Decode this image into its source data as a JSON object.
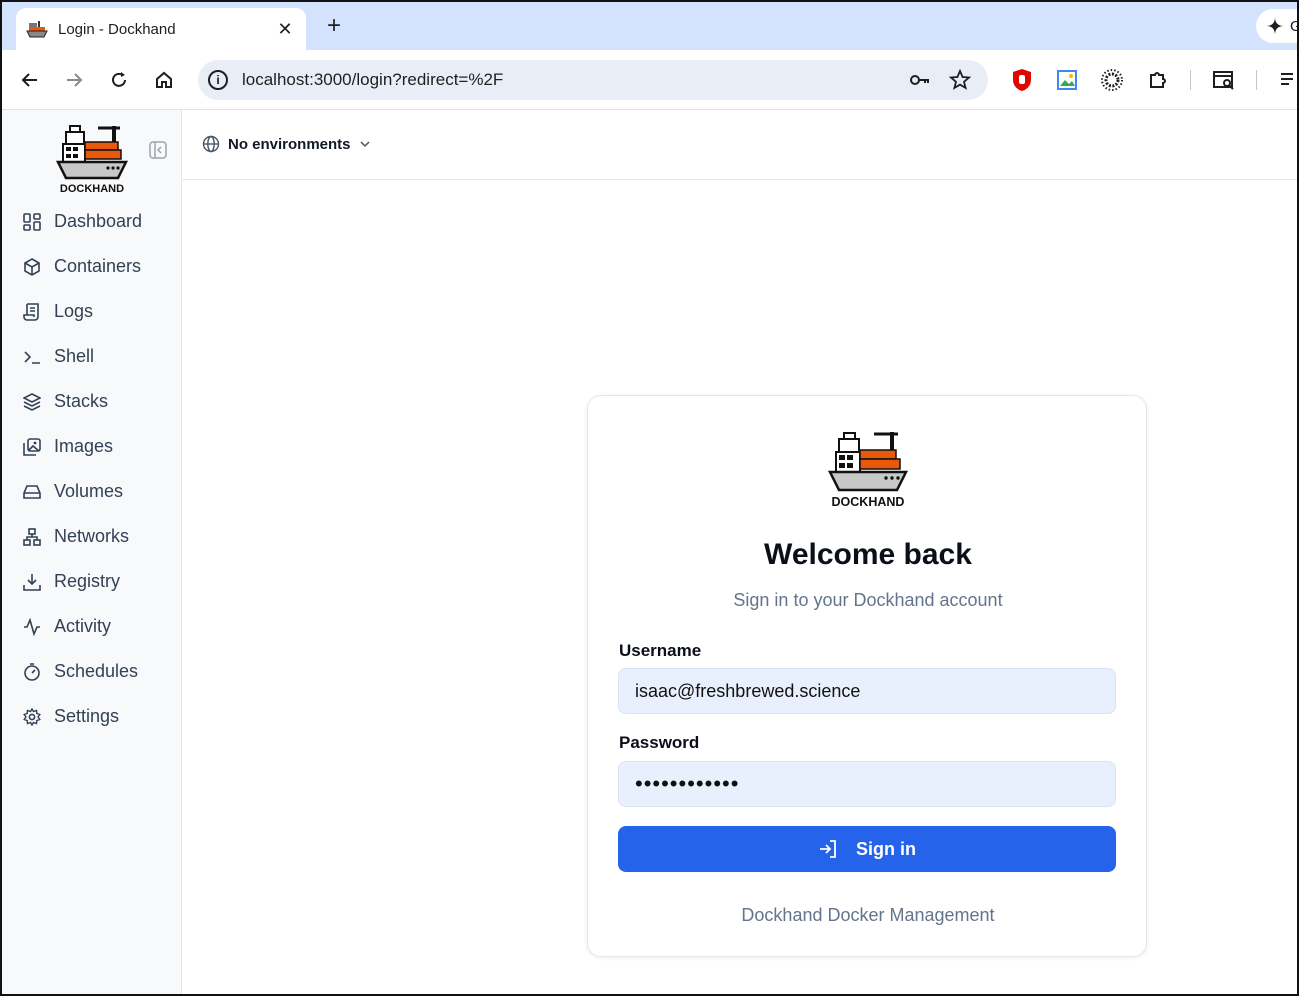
{
  "browser": {
    "tab_title": "Login - Dockhand",
    "new_tab_label": "+",
    "gemini_label": "G",
    "url": "localhost:3000/login?redirect=%2F"
  },
  "sidebar": {
    "logo_text": "DOCKHAND",
    "items": [
      {
        "label": "Dashboard",
        "icon": "dashboard-icon"
      },
      {
        "label": "Containers",
        "icon": "box-icon"
      },
      {
        "label": "Logs",
        "icon": "scroll-icon"
      },
      {
        "label": "Shell",
        "icon": "terminal-icon"
      },
      {
        "label": "Stacks",
        "icon": "layers-icon"
      },
      {
        "label": "Images",
        "icon": "images-icon"
      },
      {
        "label": "Volumes",
        "icon": "drive-icon"
      },
      {
        "label": "Networks",
        "icon": "network-icon"
      },
      {
        "label": "Registry",
        "icon": "download-icon"
      },
      {
        "label": "Activity",
        "icon": "activity-icon"
      },
      {
        "label": "Schedules",
        "icon": "timer-icon"
      },
      {
        "label": "Settings",
        "icon": "gear-icon"
      }
    ]
  },
  "header": {
    "environment_label": "No environments"
  },
  "login": {
    "logo_text": "DOCKHAND",
    "title": "Welcome back",
    "subtitle": "Sign in to your Dockhand account",
    "username_label": "Username",
    "username_value": "isaac@freshbrewed.science",
    "password_label": "Password",
    "password_value": "••••••••••••",
    "submit_label": "Sign in",
    "footer": "Dockhand Docker Management"
  },
  "colors": {
    "primary": "#2563eb",
    "input_bg": "#e8f0fe",
    "tabstrip": "#d3e3fd"
  }
}
